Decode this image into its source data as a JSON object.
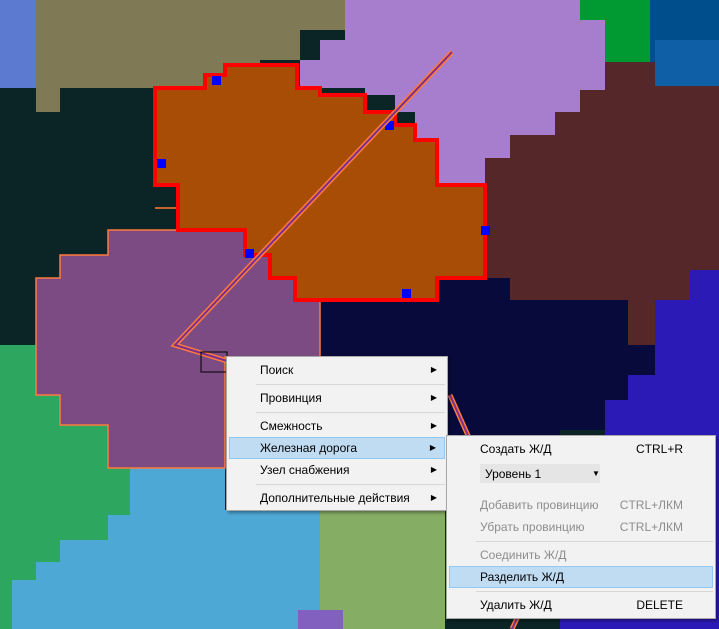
{
  "context_menu": {
    "items": [
      {
        "label": "Поиск"
      },
      {
        "label": "Провинция"
      },
      {
        "label": "Смежность"
      },
      {
        "label": "Железная дорога"
      },
      {
        "label": "Узел снабжения"
      },
      {
        "label": "Дополнительные действия"
      }
    ]
  },
  "railway_submenu": {
    "create": {
      "label": "Создать Ж/Д",
      "shortcut": "CTRL+R"
    },
    "level": {
      "value": "Уровень 1"
    },
    "add_province": {
      "label": "Добавить провинцию",
      "shortcut": "CTRL+ЛКМ"
    },
    "remove_province": {
      "label": "Убрать провинцию",
      "shortcut": "CTRL+ЛКМ"
    },
    "connect": {
      "label": "Соединить Ж/Д"
    },
    "split": {
      "label": "Разделить Ж/Д"
    },
    "delete": {
      "label": "Удалить Ж/Д",
      "shortcut": "DELETE"
    }
  },
  "colors": {
    "selected_outline": "#ff0000",
    "province_orange": "#a84d06",
    "province_violet": "#a77ecd",
    "province_purple": "#7d4b83",
    "province_brown": "#562729",
    "province_navy": "#090a3c",
    "menu_highlight": "#c0dcf3",
    "railway": "#ff7a3a"
  }
}
